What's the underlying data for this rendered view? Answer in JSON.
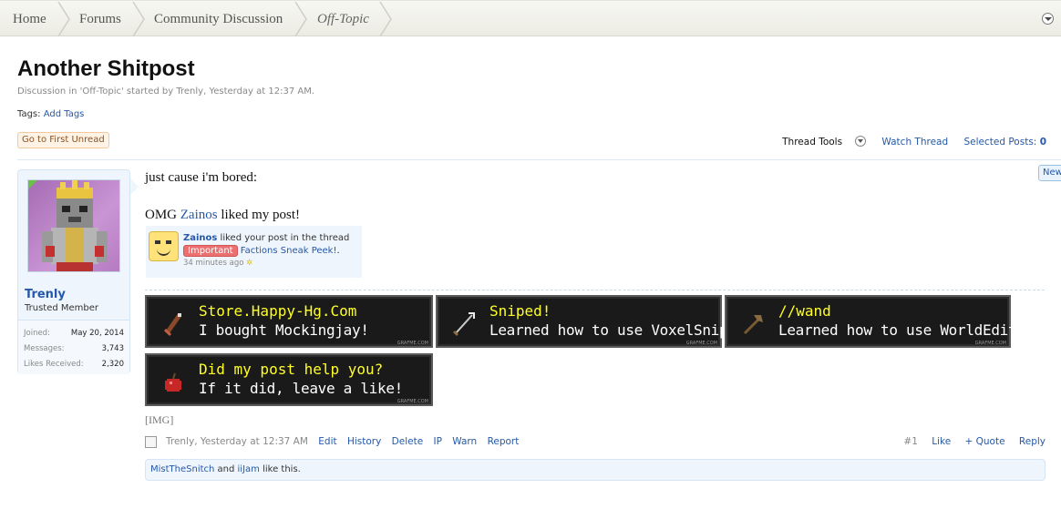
{
  "breadcrumb": {
    "items": [
      "Home",
      "Forums",
      "Community Discussion"
    ],
    "current": "Off-Topic"
  },
  "thread": {
    "title": "Another Shitpost",
    "description": "Discussion in 'Off-Topic' started by Trenly, Yesterday at 12:37 AM.",
    "tags_label": "Tags:",
    "add_tags": "Add Tags",
    "go_first_unread": "Go to First Unread"
  },
  "tools": {
    "thread_tools": "Thread Tools",
    "watch_thread": "Watch Thread",
    "selected_posts": "Selected Posts:",
    "selected_count": "0"
  },
  "user": {
    "name": "Trenly",
    "title": "Trusted Member",
    "stats": [
      {
        "label": "Joined:",
        "value": "May 20, 2014"
      },
      {
        "label": "Messages:",
        "value": "3,743"
      },
      {
        "label": "Likes Received:",
        "value": "2,320"
      }
    ]
  },
  "post": {
    "line1": "just cause i'm bored:",
    "line2_pre": "OMG ",
    "line2_user": "Zainos",
    "line2_post": " liked my post!",
    "notification": {
      "user": "Zainos",
      "text": " liked your post in the thread",
      "badge": "Important",
      "thread": "Factions Sneak Peek!",
      "thread_suffix": ".",
      "time": "34 minutes ago"
    },
    "new_tab": "New",
    "achievements": [
      {
        "title": "Store.Happy-Hg.Com",
        "text": "I bought Mockingjay!",
        "icon": "bow-icon",
        "watermark": "GRAFME.COM"
      },
      {
        "title": "Sniped!",
        "text": "Learned how to use VoxelSniper",
        "icon": "arrow-icon",
        "watermark": "GRAFME.COM"
      },
      {
        "title": "//wand",
        "text": "Learned how to use WorldEdit",
        "icon": "axe-icon",
        "watermark": "GRAFME.COM"
      },
      {
        "title": "Did my post help you?",
        "text": "If it did, leave a like!",
        "icon": "apple-icon",
        "watermark": "GRAFME.COM"
      }
    ],
    "img_tag": "[IMG]",
    "meta": {
      "author_time": "Trenly, Yesterday at 12:37 AM",
      "actions": [
        "Edit",
        "History",
        "Delete",
        "IP",
        "Warn",
        "Report"
      ],
      "post_number": "#1",
      "like": "Like",
      "quote": "+ Quote",
      "reply": "Reply"
    },
    "likes": {
      "user1": "MistTheSnitch",
      "and": " and ",
      "user2": "iiJam",
      "suffix": " like this."
    }
  },
  "colors": {
    "link": "#2558a8",
    "achievement_title": "#ffff26",
    "badge": "#ec7070"
  }
}
